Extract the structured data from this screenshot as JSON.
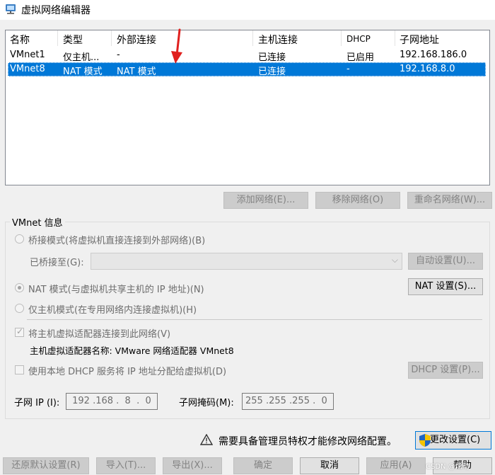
{
  "window": {
    "title": "虚拟网络编辑器",
    "icon": "vmware-network-icon"
  },
  "table": {
    "columns": [
      "名称",
      "类型",
      "外部连接",
      "主机连接",
      "DHCP",
      "子网地址"
    ],
    "rows": [
      {
        "name": "VMnet1",
        "type": "仅主机...",
        "external": "-",
        "host": "已连接",
        "dhcp": "已启用",
        "subnet": "192.168.186.0",
        "selected": false
      },
      {
        "name": "VMnet8",
        "type": "NAT 模式",
        "external": "NAT 模式",
        "host": "已连接",
        "dhcp": "-",
        "subnet": "192.168.8.0",
        "selected": true
      }
    ]
  },
  "annotation": {
    "arrow_color": "#e0201e"
  },
  "list_buttons": {
    "add": "添加网络(E)...",
    "remove": "移除网络(O)",
    "rename": "重命名网络(W)..."
  },
  "vmnet_info": {
    "label": "VMnet 信息",
    "bridge_mode": "桥接模式(将虚拟机直接连接到外部网络)(B)",
    "bridged_to": "已桥接至(G):",
    "bridged_value": "",
    "auto_settings": "自动设置(U)...",
    "nat_mode": "NAT 模式(与虚拟机共享主机的 IP 地址)(N)",
    "nat_settings": "NAT 设置(S)...",
    "host_only": "仅主机模式(在专用网络内连接虚拟机)(H)",
    "connect_adapter": "将主机虚拟适配器连接到此网络(V)",
    "adapter_name": "主机虚拟适配器名称: VMware 网络适配器 VMnet8",
    "use_dhcp": "使用本地 DHCP 服务将 IP 地址分配给虚拟机(D)",
    "dhcp_settings": "DHCP 设置(P)...",
    "subnet_ip_label": "子网 IP (I):",
    "subnet_ip": " 192 .168 .  8  .  0",
    "subnet_mask_label": "子网掩码(M):",
    "subnet_mask": "255 .255 .255 .  0",
    "selected_mode": "nat",
    "connect_adapter_checked": true,
    "use_dhcp_checked": false
  },
  "admin": {
    "message": "需要具备管理员特权才能修改网络配置。",
    "change_settings": "更改设置(C)"
  },
  "footer": {
    "restore": "还原默认设置(R)",
    "import": "导入(T)...",
    "export": "导出(X)...",
    "ok": "确定",
    "cancel": "取消",
    "apply": "应用(A)",
    "help": "帮助"
  },
  "watermark": "CSDN @炫动",
  "colors": {
    "selection": "#0078d7",
    "arrow": "#e0201e"
  }
}
